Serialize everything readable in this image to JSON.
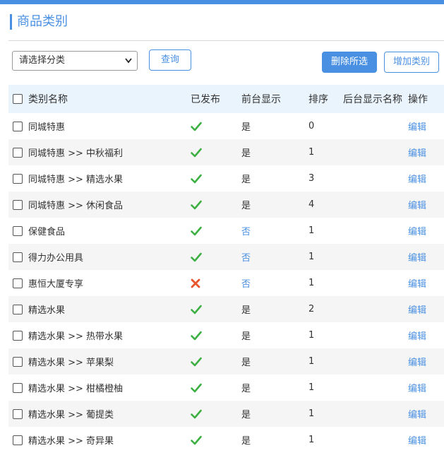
{
  "page_title": "商品类别",
  "filter": {
    "selected": "请选择分类"
  },
  "buttons": {
    "query": "查询",
    "delete_selected": "删除所选",
    "add_category": "增加类别"
  },
  "columns": {
    "name": "类别名称",
    "published": "已发布",
    "front_display": "前台显示",
    "sort": "排序",
    "back_display_name": "后台显示名称",
    "operation": "操作"
  },
  "colors": {
    "accent": "#4a90e2",
    "published_yes": "#3cb043",
    "published_no": "#e8542b"
  },
  "rows": [
    {
      "name": "同城特惠",
      "published": "check-icon",
      "front": "是",
      "sort": "0",
      "op": "编辑"
    },
    {
      "name": "同城特惠 >> 中秋福利",
      "published": "check-icon",
      "front": "是",
      "sort": "1",
      "op": "编辑"
    },
    {
      "name": "同城特惠 >> 精选水果",
      "published": "check-icon",
      "front": "是",
      "sort": "3",
      "op": "编辑"
    },
    {
      "name": "同城特惠 >> 休闲食品",
      "published": "check-icon",
      "front": "是",
      "sort": "4",
      "op": "编辑"
    },
    {
      "name": "保健食品",
      "published": "check-icon",
      "front": "否",
      "sort": "1",
      "op": "编辑"
    },
    {
      "name": "得力办公用具",
      "published": "check-icon",
      "front": "否",
      "sort": "1",
      "op": "编辑"
    },
    {
      "name": "惠恒大厦专享",
      "published": "cross-icon",
      "front": "否",
      "sort": "1",
      "op": "编辑"
    },
    {
      "name": "精选水果",
      "published": "check-icon",
      "front": "是",
      "sort": "2",
      "op": "编辑"
    },
    {
      "name": "精选水果 >> 热带水果",
      "published": "check-icon",
      "front": "是",
      "sort": "1",
      "op": "编辑"
    },
    {
      "name": "精选水果 >> 苹果梨",
      "published": "check-icon",
      "front": "是",
      "sort": "1",
      "op": "编辑"
    },
    {
      "name": "精选水果 >> 柑橘橙柚",
      "published": "check-icon",
      "front": "是",
      "sort": "1",
      "op": "编辑"
    },
    {
      "name": "精选水果 >> 葡提类",
      "published": "check-icon",
      "front": "是",
      "sort": "1",
      "op": "编辑"
    },
    {
      "name": "精选水果 >> 奇异果",
      "published": "check-icon",
      "front": "是",
      "sort": "1",
      "op": "编辑"
    }
  ]
}
